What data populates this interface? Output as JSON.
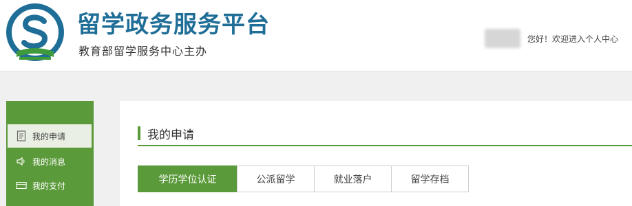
{
  "header": {
    "title": "留学政务服务平台",
    "subtitle": "教育部留学服务中心主办",
    "greeting": "您好！欢迎进入个人中心",
    "logo_icon": "cscse-logo-icon"
  },
  "sidebar": {
    "items": [
      {
        "label": "我的申请",
        "icon": "document-icon",
        "active": true
      },
      {
        "label": "我的消息",
        "icon": "speaker-icon",
        "active": false
      },
      {
        "label": "我的支付",
        "icon": "card-icon",
        "active": false
      }
    ]
  },
  "main": {
    "section_title": "我的申请",
    "tabs": [
      {
        "label": "学历学位认证",
        "active": true
      },
      {
        "label": "公派留学",
        "active": false
      },
      {
        "label": "就业落户",
        "active": false
      },
      {
        "label": "留学存档",
        "active": false
      }
    ]
  },
  "colors": {
    "brand_green": "#5b9a3a",
    "brand_blue": "#1f6e97",
    "active_item_bg": "#e9efe2"
  }
}
